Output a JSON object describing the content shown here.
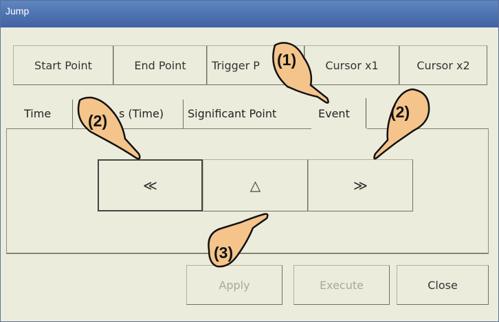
{
  "window": {
    "title": "Jump"
  },
  "target_buttons": [
    "Start Point",
    "End Point",
    "Trigger P",
    "Cursor x1",
    "Cursor x2"
  ],
  "tabs": [
    "Time",
    "s (Time)",
    "Significant Point",
    "Event"
  ],
  "nav": {
    "prev": "≪",
    "up": "△",
    "next": "≫"
  },
  "footer": {
    "apply": "Apply",
    "execute": "Execute",
    "close": "Close"
  },
  "callouts": {
    "c1": "(1)",
    "c2_left": "(2)",
    "c2_right": "(2)",
    "c3": "(3)"
  },
  "colors": {
    "title_bar": "#4a6fb0",
    "window_bg": "#ECECDC",
    "hand_fill": "#F4C48A"
  }
}
